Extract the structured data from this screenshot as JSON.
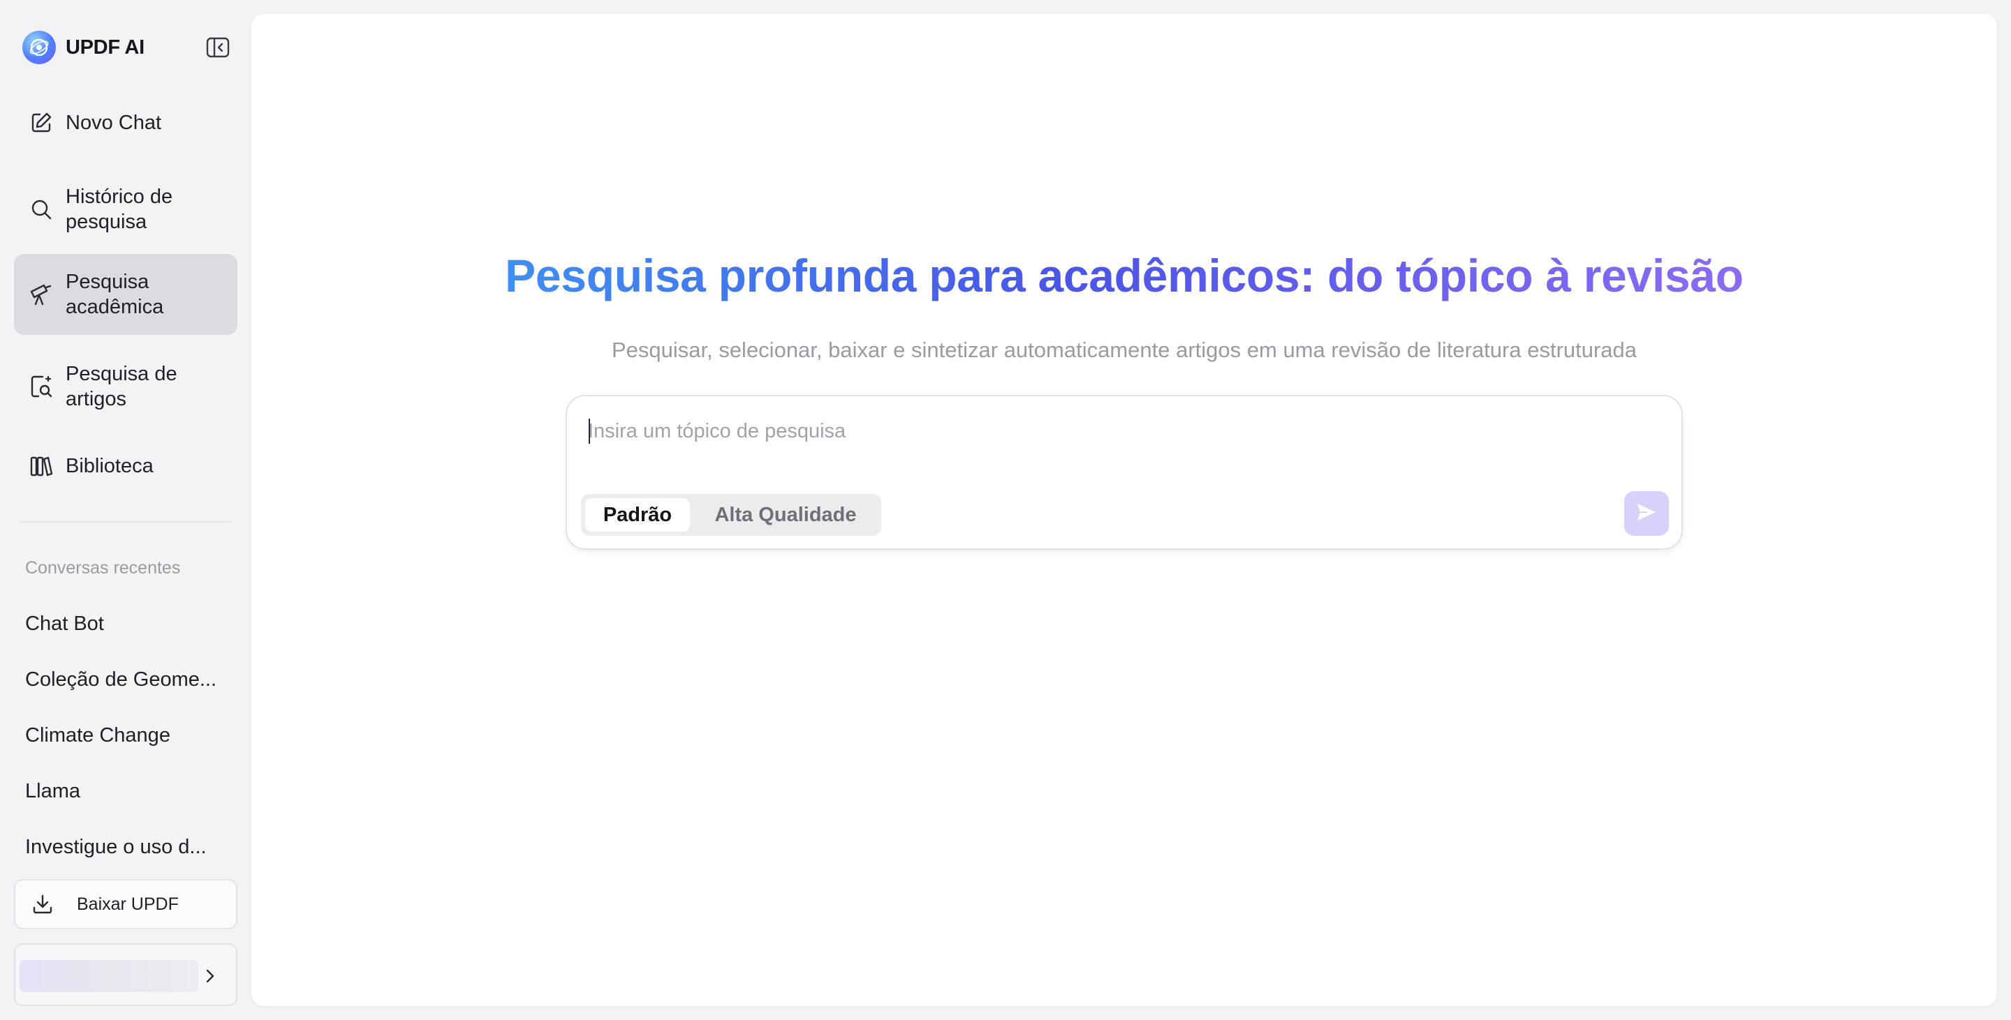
{
  "brand": {
    "name": "UPDF AI",
    "icon": "updf-logo-icon"
  },
  "sidebar": {
    "collapse_icon": "sidebar-collapse-icon",
    "nav": [
      {
        "label": "Novo Chat",
        "icon": "edit-icon",
        "active": false
      },
      {
        "label": "Histórico de pesquisa",
        "icon": "search-icon",
        "active": false
      },
      {
        "label": "Pesquisa acadêmica",
        "icon": "telescope-icon",
        "active": true
      },
      {
        "label": "Pesquisa de artigos",
        "icon": "document-search-icon",
        "active": false
      },
      {
        "label": "Biblioteca",
        "icon": "library-icon",
        "active": false
      }
    ],
    "recent_title": "Conversas recentes",
    "recent": [
      "Chat Bot",
      "Coleção de Geome...",
      "Climate Change",
      "Llama",
      "Investigue o uso d..."
    ],
    "download_label": "Baixar UPDF",
    "download_icon": "download-icon",
    "account_chevron": "chevron-right-icon"
  },
  "main": {
    "title": "Pesquisa profunda para acadêmicos: do tópico à revisão",
    "subtitle": "Pesquisar, selecionar, baixar e sintetizar automaticamente artigos em uma revisão de literatura estruturada",
    "search": {
      "placeholder": "Insira um tópico de pesquisa",
      "value": ""
    },
    "modes": {
      "active": "Padrão",
      "inactive": "Alta Qualidade"
    },
    "send_icon": "send-icon"
  },
  "colors": {
    "accent": "#4a55e8",
    "title_gradient_start": "#3f8ff2",
    "title_gradient_end": "#8a6cf2",
    "send_button": "#d6d2fb",
    "active_nav": "#dcdce0"
  }
}
